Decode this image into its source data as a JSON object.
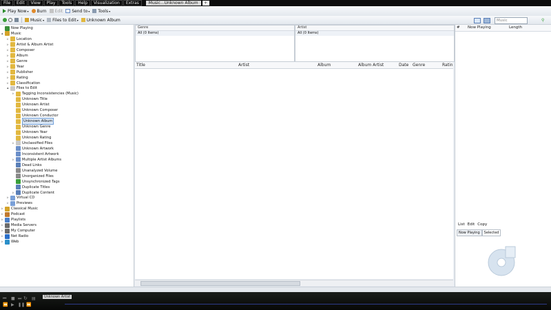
{
  "menubar": {
    "items": [
      "File",
      "Edit",
      "View",
      "Play",
      "Tools",
      "Help",
      "Visualization",
      "Extras"
    ],
    "tab_label": "Music...Unknown Album",
    "new_tab": "+"
  },
  "toolbar1": {
    "play_now": "Play Now",
    "burn": "Burn",
    "edit": "Edit",
    "send_to": "Send to",
    "tools": "Tools"
  },
  "toolbar2": {
    "music": "Music",
    "files_to_edit": "Files to Edit",
    "unknown_album": "Unknown Album",
    "search_placeholder": "Music"
  },
  "tree": {
    "items": [
      {
        "label": "Now Playing",
        "level": 0,
        "color": "#3a8f3a"
      },
      {
        "label": "Music",
        "level": 0,
        "color": "#d4a32a",
        "exp": "▴"
      },
      {
        "label": "Location",
        "level": 1,
        "color": "#e2b840",
        "exp": "▹"
      },
      {
        "label": "Artist & Album Artist",
        "level": 1,
        "color": "#e2b840",
        "exp": "▹"
      },
      {
        "label": "Composer",
        "level": 1,
        "color": "#e2b840",
        "exp": "▹"
      },
      {
        "label": "Album",
        "level": 1,
        "color": "#e2b840",
        "exp": "▹"
      },
      {
        "label": "Genre",
        "level": 1,
        "color": "#e2b840",
        "exp": "▹"
      },
      {
        "label": "Year",
        "level": 1,
        "color": "#e2b840",
        "exp": "▹"
      },
      {
        "label": "Publisher",
        "level": 1,
        "color": "#e2b840",
        "exp": "▹"
      },
      {
        "label": "Rating",
        "level": 1,
        "color": "#e2b840",
        "exp": "▹"
      },
      {
        "label": "Classification",
        "level": 1,
        "color": "#e2b840",
        "exp": "▹"
      },
      {
        "label": "Files to Edit",
        "level": 1,
        "color": "#c9c9c9",
        "exp": "▴"
      },
      {
        "label": "Tagging Inconsistencies (Music)",
        "level": 2,
        "color": "#e2b840",
        "exp": "▹"
      },
      {
        "label": "Unknown Title",
        "level": 2,
        "color": "#e2b840"
      },
      {
        "label": "Unknown Artist",
        "level": 2,
        "color": "#e2b840"
      },
      {
        "label": "Unknown Composer",
        "level": 2,
        "color": "#e2b840"
      },
      {
        "label": "Unknown Conductor",
        "level": 2,
        "color": "#e2b840"
      },
      {
        "label": "Unknown Album",
        "level": 2,
        "color": "#e2b840",
        "selected": true
      },
      {
        "label": "Unknown Genre",
        "level": 2,
        "color": "#e2b840"
      },
      {
        "label": "Unknown Year",
        "level": 2,
        "color": "#e2b840"
      },
      {
        "label": "Unknown Rating",
        "level": 2,
        "color": "#e2b840"
      },
      {
        "label": "Unclassified Files",
        "level": 2,
        "color": "#c9c9c9",
        "exp": "▹"
      },
      {
        "label": "Unknown Artwork",
        "level": 2,
        "color": "#6b8fc9"
      },
      {
        "label": "Inconsistent Artwork",
        "level": 2,
        "color": "#6b8fc9"
      },
      {
        "label": "Multiple Artist Albums",
        "level": 2,
        "color": "#6b8fc9",
        "exp": "▹"
      },
      {
        "label": "Dead Links",
        "level": 2,
        "color": "#5a7fb8"
      },
      {
        "label": "Unanalyzed Volume",
        "level": 2,
        "color": "#8a8a8a"
      },
      {
        "label": "Unorganized Files",
        "level": 2,
        "color": "#8a8a8a"
      },
      {
        "label": "Unsynchronized Tags",
        "level": 2,
        "color": "#3a9f3a"
      },
      {
        "label": "Duplicate Titles",
        "level": 2,
        "color": "#5a7fb8"
      },
      {
        "label": "Duplicate Content",
        "level": 2,
        "color": "#5a7fb8",
        "exp": "▹"
      },
      {
        "label": "Virtual CD",
        "level": 1,
        "color": "#7aa0d8",
        "exp": "▹"
      },
      {
        "label": "Previews",
        "level": 1,
        "color": "#7aa0d8",
        "exp": "▹"
      },
      {
        "label": "Classical Music",
        "level": 0,
        "color": "#d4a32a",
        "exp": "▹"
      },
      {
        "label": "Podcast",
        "level": 0,
        "color": "#c07a30",
        "exp": "▹"
      },
      {
        "label": "Playlists",
        "level": 0,
        "color": "#4a7fc9",
        "exp": "▹"
      },
      {
        "label": "Media Servers",
        "level": 0,
        "color": "#6b6b6b",
        "exp": "▹"
      },
      {
        "label": "My Computer",
        "level": 0,
        "color": "#6b6b6b",
        "exp": "▹"
      },
      {
        "label": "Net Radio",
        "level": 0,
        "color": "#2a6fc9",
        "exp": "▹"
      },
      {
        "label": "Web",
        "level": 0,
        "color": "#2a8fc9",
        "exp": "▹"
      }
    ]
  },
  "genre_pane": {
    "header": "Genre",
    "row": "All (0 Items)"
  },
  "artist_pane": {
    "header": "Artist",
    "row": "All (0 Items)"
  },
  "columns": [
    "Title",
    "Artist",
    "Album",
    "Album Artist",
    "Date",
    "Genre",
    "Ratin"
  ],
  "right_pane": {
    "columns": [
      "#",
      "Now Playing",
      "Length"
    ],
    "menu": [
      "List",
      "Edit",
      "Copy"
    ],
    "tabs": [
      "Now Playing",
      "Selected"
    ]
  },
  "player": {
    "now_playing_label": "Unknown Artist"
  }
}
